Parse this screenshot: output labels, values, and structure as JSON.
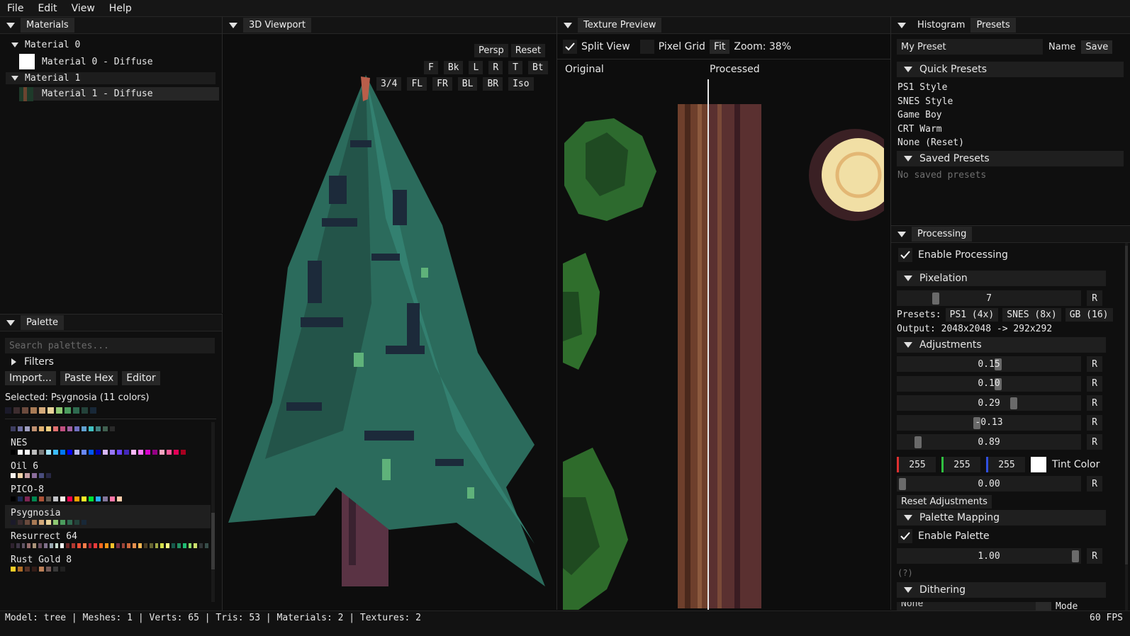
{
  "menu": [
    "File",
    "Edit",
    "View",
    "Help"
  ],
  "materials": {
    "title": "Materials",
    "items": [
      {
        "label": "Material 0",
        "child": "Material 0 - Diffuse"
      },
      {
        "label": "Material 1",
        "child": "Material 1 - Diffuse"
      }
    ]
  },
  "palette": {
    "title": "Palette",
    "search_placeholder": "Search palettes...",
    "filters_label": "Filters",
    "import_label": "Import...",
    "paste_label": "Paste Hex",
    "editor_label": "Editor",
    "selected_text": "Selected: Psygnosia (11 colors)",
    "selected_colors": [
      "#1b1a2a",
      "#3d2d2f",
      "#6b4a3d",
      "#a87a55",
      "#d4aa7a",
      "#e9d29a",
      "#8fc873",
      "#4b9c5e",
      "#2e6a4f",
      "#23423a",
      "#182838"
    ],
    "lists": [
      {
        "name": "",
        "colors": [
          "#3d3d60",
          "#6f6fa0",
          "#a0a0c0",
          "#c09070",
          "#e0b070",
          "#f0d080",
          "#e07070",
          "#c05080",
          "#a060a0",
          "#7070c0",
          "#60a0d0",
          "#40c0c0",
          "#408080",
          "#406050",
          "#2a2a2a"
        ]
      },
      {
        "name": "NES",
        "colors": [
          "#000000",
          "#fcfcfc",
          "#f8f8f8",
          "#bcbcbc",
          "#7c7c7c",
          "#a4e4fc",
          "#3cbcfc",
          "#0078f8",
          "#0000fc",
          "#b8b8f8",
          "#6888fc",
          "#0058f8",
          "#0000bc",
          "#d8b8f8",
          "#9878f8",
          "#6844fc",
          "#4428bc",
          "#f8b8f8",
          "#f878f8",
          "#d800cc",
          "#940084",
          "#f8a4c0",
          "#f85898",
          "#e40058",
          "#a80020"
        ]
      },
      {
        "name": "Oil 6",
        "colors": [
          "#fbf5ef",
          "#f2d3ab",
          "#c69fa5",
          "#8b6d9c",
          "#494d7e",
          "#272744"
        ]
      },
      {
        "name": "PICO-8",
        "colors": [
          "#000000",
          "#1d2b53",
          "#7e2553",
          "#008751",
          "#ab5236",
          "#5f574f",
          "#c2c3c7",
          "#fff1e8",
          "#ff004d",
          "#ffa300",
          "#ffec27",
          "#00e436",
          "#29adff",
          "#83769c",
          "#ff77a8",
          "#ffccaa"
        ]
      },
      {
        "name": "Psygnosia",
        "colors": [
          "#1b1a2a",
          "#3d2d2f",
          "#6b4a3d",
          "#a87a55",
          "#d4aa7a",
          "#e9d29a",
          "#8fc873",
          "#4b9c5e",
          "#2e6a4f",
          "#23423a",
          "#182838"
        ]
      },
      {
        "name": "Resurrect 64",
        "colors": [
          "#2e222f",
          "#3e3546",
          "#625565",
          "#966c6c",
          "#ab947a",
          "#694f62",
          "#7f708a",
          "#9babb2",
          "#c7dcd0",
          "#ffffff",
          "#6e2727",
          "#b33831",
          "#ea4f36",
          "#f57d4a",
          "#ae2334",
          "#e83b3b",
          "#fb6b1d",
          "#f79617",
          "#f9c22b",
          "#7a3045",
          "#9e4539",
          "#cd683d",
          "#e6904e",
          "#fbb954",
          "#4c3e24",
          "#676633",
          "#a2a947",
          "#d5e04b",
          "#fbff86",
          "#165a4c",
          "#239063",
          "#1ebc73",
          "#91db69",
          "#cddf6c",
          "#313638",
          "#374e4a"
        ]
      },
      {
        "name": "Rust Gold 8",
        "colors": [
          "#f6cd26",
          "#ac6b26",
          "#563226",
          "#331c17",
          "#bb7f57",
          "#725956",
          "#393939",
          "#202020"
        ]
      }
    ]
  },
  "viewport": {
    "title": "3D Viewport",
    "persp": "Persp",
    "reset": "Reset",
    "row1": [
      "F",
      "Bk",
      "L",
      "R",
      "T",
      "Bt"
    ],
    "row2": [
      "3/4",
      "FL",
      "FR",
      "BL",
      "BR",
      "Iso"
    ]
  },
  "texture": {
    "title": "Texture Preview",
    "split_view": "Split View",
    "pixel_grid": "Pixel Grid",
    "fit": "Fit",
    "zoom": "Zoom: 38%",
    "original": "Original",
    "processed": "Processed"
  },
  "presets_panel": {
    "tab_histogram": "Histogram",
    "tab_presets": "Presets",
    "preset_name_value": "My Preset",
    "name_label": "Name",
    "save_label": "Save",
    "quick_title": "Quick Presets",
    "quick": [
      "PS1 Style",
      "SNES Style",
      "Game Boy",
      "CRT Warm",
      "None (Reset)"
    ],
    "saved_title": "Saved Presets",
    "saved_empty": "No saved presets"
  },
  "processing": {
    "title": "Processing",
    "enable_label": "Enable Processing",
    "pixelation_title": "Pixelation",
    "pixel_value": "7",
    "pixel_fraction": 0.1,
    "presets_label": "Presets:",
    "preset_buttons": [
      "PS1 (4x)",
      "SNES (8x)",
      "GB (16)"
    ],
    "output_text": "Output: 2048x2048 -> 292x292",
    "adjustments_title": "Adjustments",
    "sliders": [
      {
        "value": "0.15",
        "fraction": 0.55
      },
      {
        "value": "0.10",
        "fraction": 0.55
      },
      {
        "value": "0.29",
        "fraction": 0.64
      },
      {
        "value": "-0.13",
        "fraction": 0.43
      },
      {
        "value": "0.89",
        "fraction": 0.1
      }
    ],
    "tint": {
      "r": "255",
      "g": "255",
      "b": "255",
      "label": "Tint Color"
    },
    "tint_amount": "0.00",
    "reset_adjustments": "Reset Adjustments",
    "palette_mapping_title": "Palette Mapping",
    "enable_palette": "Enable Palette",
    "palette_strength": "1.00",
    "help": "(?)",
    "dithering_title": "Dithering",
    "dither_mode_value": "None",
    "dither_mode_label": "Mode",
    "r_label": "R"
  },
  "status": {
    "text": "Model: tree | Meshes: 1 | Verts: 65 | Tris: 53 | Materials: 2 | Textures: 2",
    "fps": "60 FPS"
  }
}
